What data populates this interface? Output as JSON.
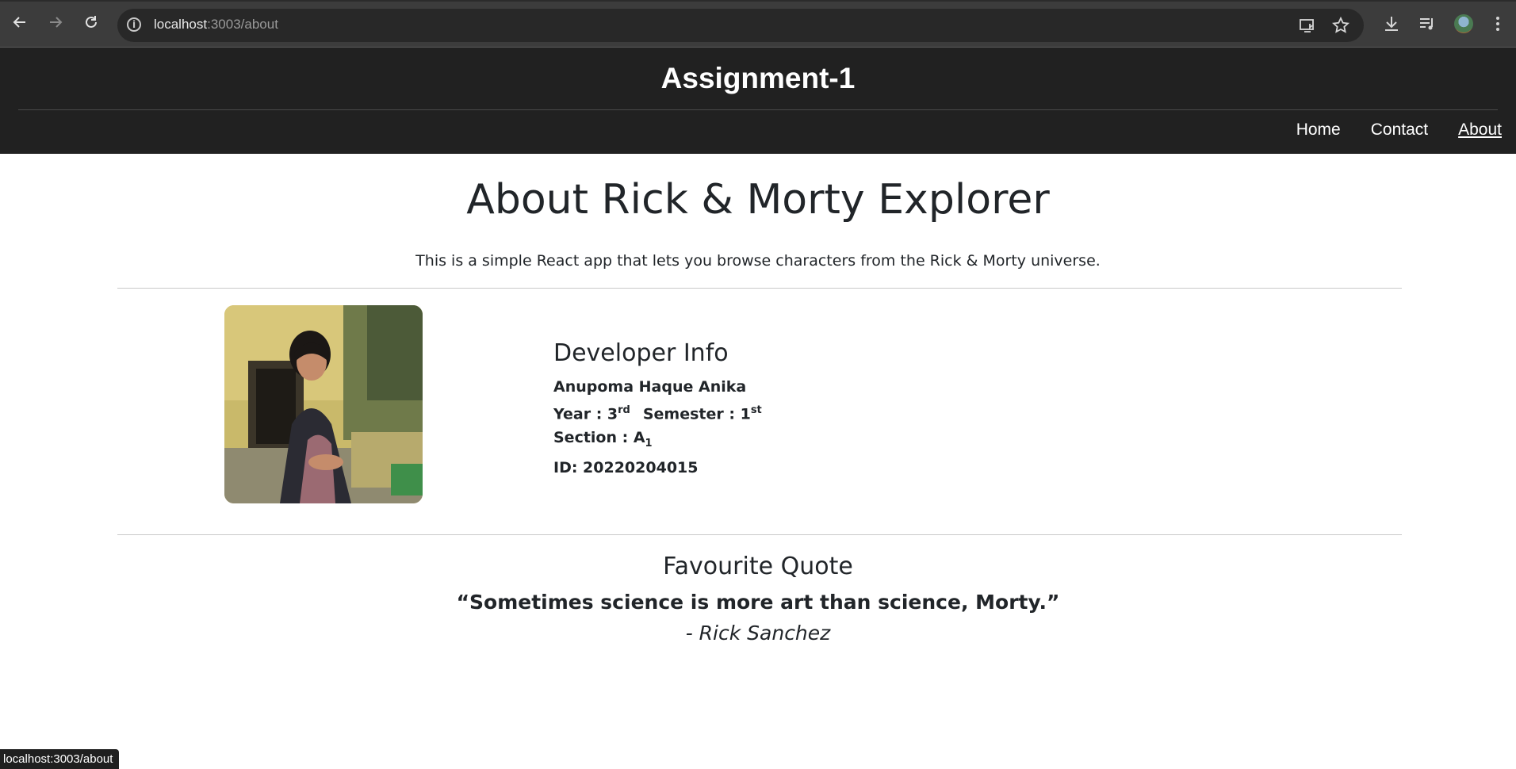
{
  "browser": {
    "url_host": "localhost",
    "url_path": ":3003/about",
    "back_icon": "arrow-left-icon",
    "forward_icon": "arrow-right-icon",
    "reload_icon": "reload-icon",
    "status_url": "localhost:3003/about"
  },
  "header": {
    "title": "Assignment-1",
    "nav": [
      {
        "label": "Home",
        "active": false
      },
      {
        "label": "Contact",
        "active": false
      },
      {
        "label": "About",
        "active": true
      }
    ]
  },
  "main": {
    "heading": "About Rick & Morty Explorer",
    "intro": "This is a simple React app that lets you browse characters from the Rick & Morty universe.",
    "developer": {
      "heading": "Developer Info",
      "name": "Anupoma Haque Anika",
      "year_label": "Year : 3",
      "year_sup": "rd",
      "semester_label": "Semester : 1",
      "semester_sup": "st",
      "section_label": "Section : A",
      "section_sub": "1",
      "id": "ID: 20220204015"
    },
    "quote": {
      "heading": "Favourite Quote",
      "text": "“Sometimes science is more art than science, Morty.”",
      "author": "- Rick Sanchez"
    }
  }
}
